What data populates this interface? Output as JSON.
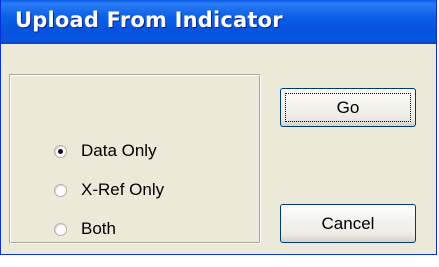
{
  "window": {
    "title": "Upload From Indicator"
  },
  "options": {
    "items": [
      {
        "label": "Data Only",
        "checked": true
      },
      {
        "label": "X-Ref Only",
        "checked": false
      },
      {
        "label": "Both",
        "checked": false
      }
    ]
  },
  "buttons": {
    "go_label": "Go",
    "cancel_label": "Cancel"
  },
  "colors": {
    "titlebar": "#0a5ae3",
    "title_text": "#ffffff",
    "dialog_background": "#ece9d8",
    "button_border": "#003c74"
  }
}
